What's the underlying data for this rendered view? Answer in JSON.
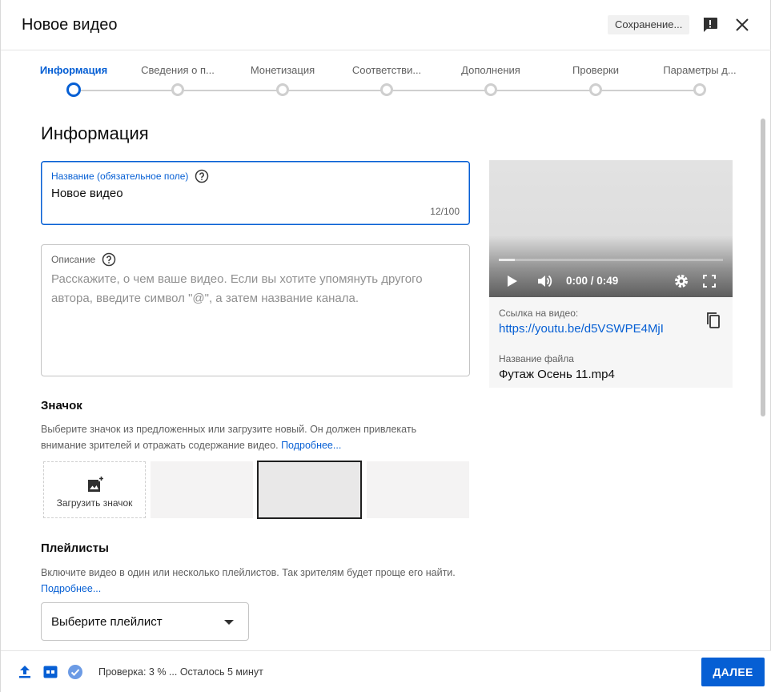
{
  "header": {
    "title": "Новое видео",
    "saving_status": "Сохранение..."
  },
  "stepper": {
    "steps": [
      {
        "label": "Информация",
        "active": true
      },
      {
        "label": "Сведения о п...",
        "active": false
      },
      {
        "label": "Монетизация",
        "active": false
      },
      {
        "label": "Соответстви...",
        "active": false
      },
      {
        "label": "Дополнения",
        "active": false
      },
      {
        "label": "Проверки",
        "active": false
      },
      {
        "label": "Параметры д...",
        "active": false
      }
    ]
  },
  "main": {
    "section_title": "Информация",
    "title_field": {
      "label": "Название (обязательное поле)",
      "value": "Новое видео",
      "counter": "12/100"
    },
    "description_field": {
      "label": "Описание",
      "placeholder": "Расскажите, о чем ваше видео. Если вы хотите упомянуть другого автора, введите символ \"@\", а затем название канала."
    },
    "thumbnail": {
      "heading": "Значок",
      "description": "Выберите значок из предложенных или загрузите новый. Он должен привлекать внимание зрителей и отражать содержание видео.",
      "more_link": "Подробнее...",
      "upload_label": "Загрузить значок"
    },
    "playlists": {
      "heading": "Плейлисты",
      "description": "Включите видео в один или несколько плейлистов. Так зрителям будет проще его найти.",
      "more_link": "Подробнее...",
      "select_value": "Выберите плейлист"
    }
  },
  "video_panel": {
    "time": "0:00 / 0:49",
    "progress": 0.07,
    "link_label": "Ссылка на видео:",
    "link": "https://youtu.be/d5VSWPE4MjI",
    "file_label": "Название файла",
    "file_name": "Футаж Осень 11.mp4"
  },
  "footer": {
    "status": "Проверка: 3 % ... Осталось 5 минут",
    "next_label": "ДАЛЕЕ"
  },
  "colors": {
    "accent": "#065fd4",
    "text": "#0d0d0d",
    "muted": "#606060"
  }
}
